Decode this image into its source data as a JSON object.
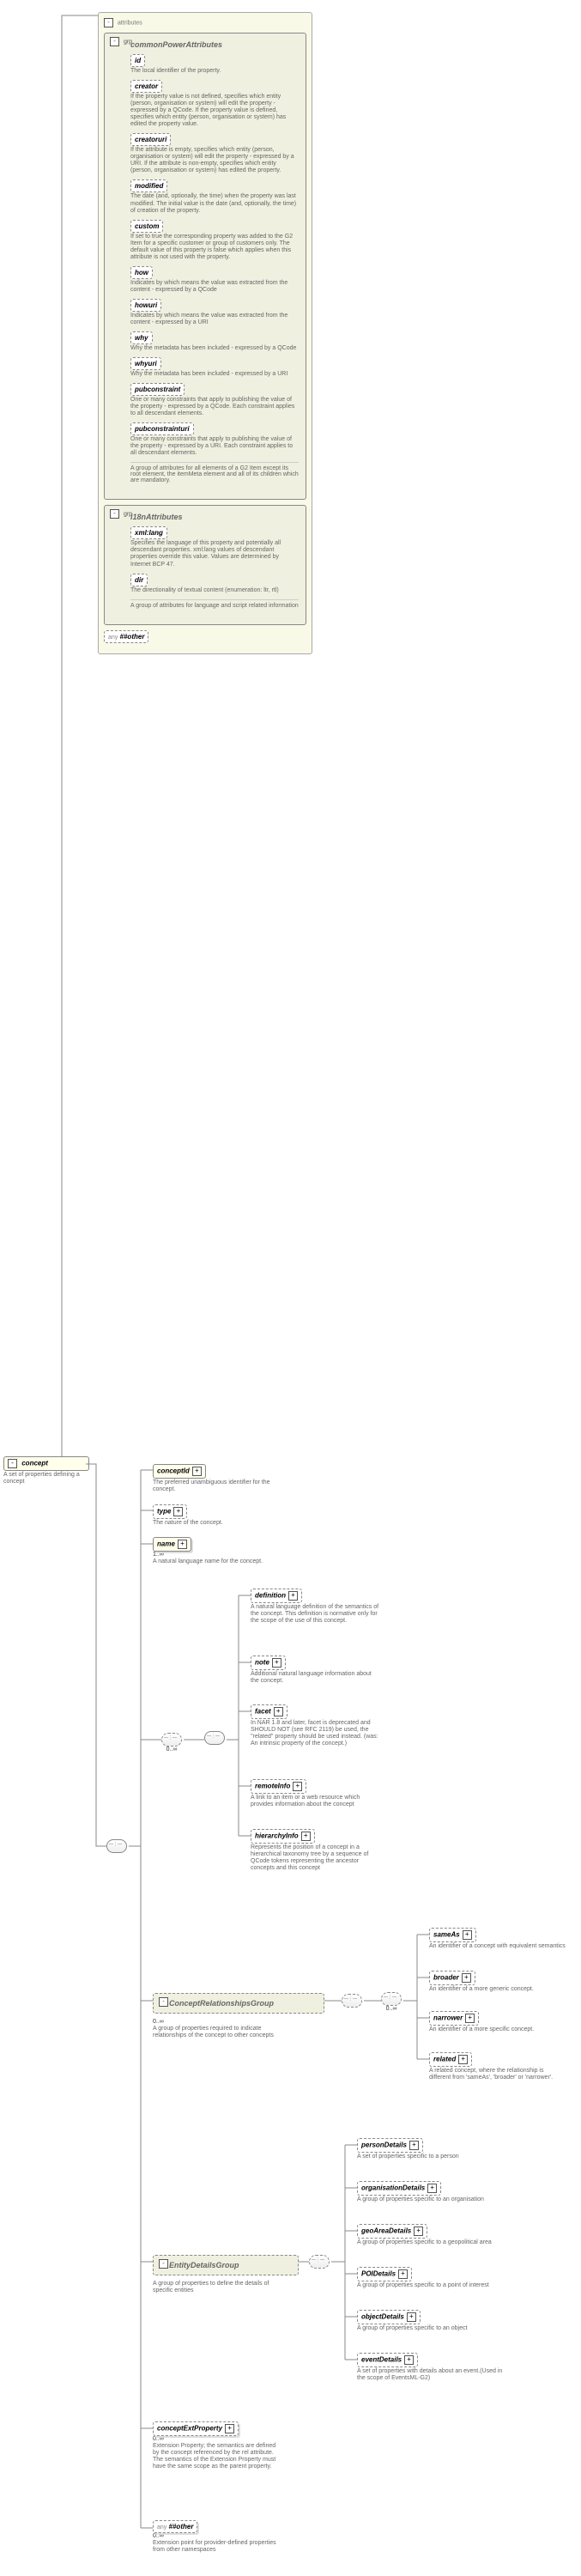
{
  "root": {
    "concept": {
      "label": "concept",
      "desc": "A set of properties defining a concept"
    }
  },
  "attributes": {
    "title": "attributes",
    "commonPowerAttributes": {
      "title": "commonPowerAttributes",
      "prefix": "grp",
      "id": {
        "label": "id",
        "desc": "The local identifier of the property."
      },
      "creator": {
        "label": "creator",
        "desc": "If the property value is not defined, specifies which entity (person, organisation or system) will edit the property - expressed by a QCode. If the property value is defined, specifies which entity (person, organisation or system) has edited the property value."
      },
      "creatoruri": {
        "label": "creatoruri",
        "desc": "If the attribute is empty, specifies which entity (person, organisation or system) will edit the property - expressed by a URI. If the attribute is non-empty, specifies which entity (person, organisation or system) has edited the property."
      },
      "modified": {
        "label": "modified",
        "desc": "The date (and, optionally, the time) when the property was last modified. The initial value is the date (and, optionally, the time) of creation of the property."
      },
      "custom": {
        "label": "custom",
        "desc": "If set to true the corresponding property was added to the G2 Item for a specific customer or group of customers only. The default value of this property is false which applies when this attribute is not used with the property."
      },
      "how": {
        "label": "how",
        "desc": "Indicates by which means the value was extracted from the content - expressed by a QCode"
      },
      "howuri": {
        "label": "howuri",
        "desc": "Indicates by which means the value was extracted from the content - expressed by a URI"
      },
      "why": {
        "label": "why",
        "desc": "Why the metadata has been included - expressed by a QCode"
      },
      "whyuri": {
        "label": "whyuri",
        "desc": "Why the metadata has been included - expressed by a URI"
      },
      "pubconstraint": {
        "label": "pubconstraint",
        "desc": "One or many constraints that apply to publishing the value of the property - expressed by a QCode. Each constraint applies to all descendant elements."
      },
      "pubconstrainturi": {
        "label": "pubconstrainturi",
        "desc": "One or many constraints that apply to publishing the value of the property - expressed by a URI. Each constraint applies to all descendant elements."
      },
      "note": "A group of attributes for all elements of a G2 Item except its root element, the itemMeta element and all of its children which are mandatory."
    },
    "i18nAttributes": {
      "title": "i18nAttributes",
      "prefix": "grp",
      "xmllang": {
        "label": "xml:lang",
        "desc": "Specifies the language of this property and potentially all descendant properties. xml:lang values of descendant properties override this value. Values are determined by Internet BCP 47."
      },
      "dir": {
        "label": "dir",
        "desc": "The directionality of textual content (enumeration: ltr, rtl)"
      },
      "note": "A group of attributes for language and script related information"
    },
    "anyother": "##other"
  },
  "children": {
    "conceptId": {
      "label": "conceptId",
      "desc": "The preferred unambiguous identifier for the concept."
    },
    "type": {
      "label": "type",
      "desc": "The nature of the concept."
    },
    "name": {
      "label": "name",
      "card": "1..∞",
      "desc": "A natural language name for the concept."
    },
    "definition": {
      "label": "definition",
      "desc": "A natural language definition of the semantics of the concept. This definition is normative only for the scope of the use of this concept."
    },
    "note": {
      "label": "note",
      "desc": "Additional natural language information about the concept."
    },
    "facet": {
      "label": "facet",
      "desc": "In NAR 1.8 and later, facet is deprecated and SHOULD NOT (see RFC 2119) be used, the \"related\" property should be used instead. (was: An intrinsic property of the concept.)"
    },
    "remoteInfo": {
      "label": "remoteInfo",
      "desc": "A link to an item or a web resource which provides information about the concept"
    },
    "hierarchyInfo": {
      "label": "hierarchyInfo",
      "desc": "Represents the position of a concept in a hierarchical taxonomy tree by a sequence of QCode tokens representing the ancestor concepts and this concept"
    },
    "seq_card": "0..∞"
  },
  "conceptRel": {
    "title": "ConceptRelationshipsGroup",
    "desc": "A group of properties required to indicate relationships of the concept to other concepts",
    "card": "0..∞",
    "sameAs": {
      "label": "sameAs",
      "desc": "An identifier of a concept with equivalent semantics"
    },
    "broader": {
      "label": "broader",
      "desc": "An identifier of a more generic concept."
    },
    "narrower": {
      "label": "narrower",
      "desc": "An identifier of a more specific concept."
    },
    "related": {
      "label": "related",
      "desc": "A related concept, where the relationship is different from 'sameAs', 'broader' or 'narrower'."
    }
  },
  "entity": {
    "title": "EntityDetailsGroup",
    "desc": "A group of properties to define the details of specific entities",
    "personDetails": {
      "label": "personDetails",
      "desc": "A set of properties specific to a person"
    },
    "organisationDetails": {
      "label": "organisationDetails",
      "desc": "A group of properties specific to an organisation"
    },
    "geoAreaDetails": {
      "label": "geoAreaDetails",
      "desc": "A group of properties specific to a geopolitical area"
    },
    "POIDetails": {
      "label": "POIDetails",
      "desc": "A group of properties specific to a point of interest"
    },
    "objectDetails": {
      "label": "objectDetails",
      "desc": "A group of properties specific to an object"
    },
    "eventDetails": {
      "label": "eventDetails",
      "desc": "A set of properties with details about an event.(Used in the scope of EventsML-G2)"
    }
  },
  "ext": {
    "title": "conceptExtProperty",
    "card": "0..∞",
    "desc": "Extension Property; the semantics are defined by the concept referenced by the rel attribute. The semantics of the Extension Property must have the same scope as the parent property."
  },
  "tailany": {
    "label": "##other",
    "card": "0..∞",
    "desc": "Extension point for provider-defined properties from other namespaces"
  },
  "labels": {
    "any": "any"
  }
}
